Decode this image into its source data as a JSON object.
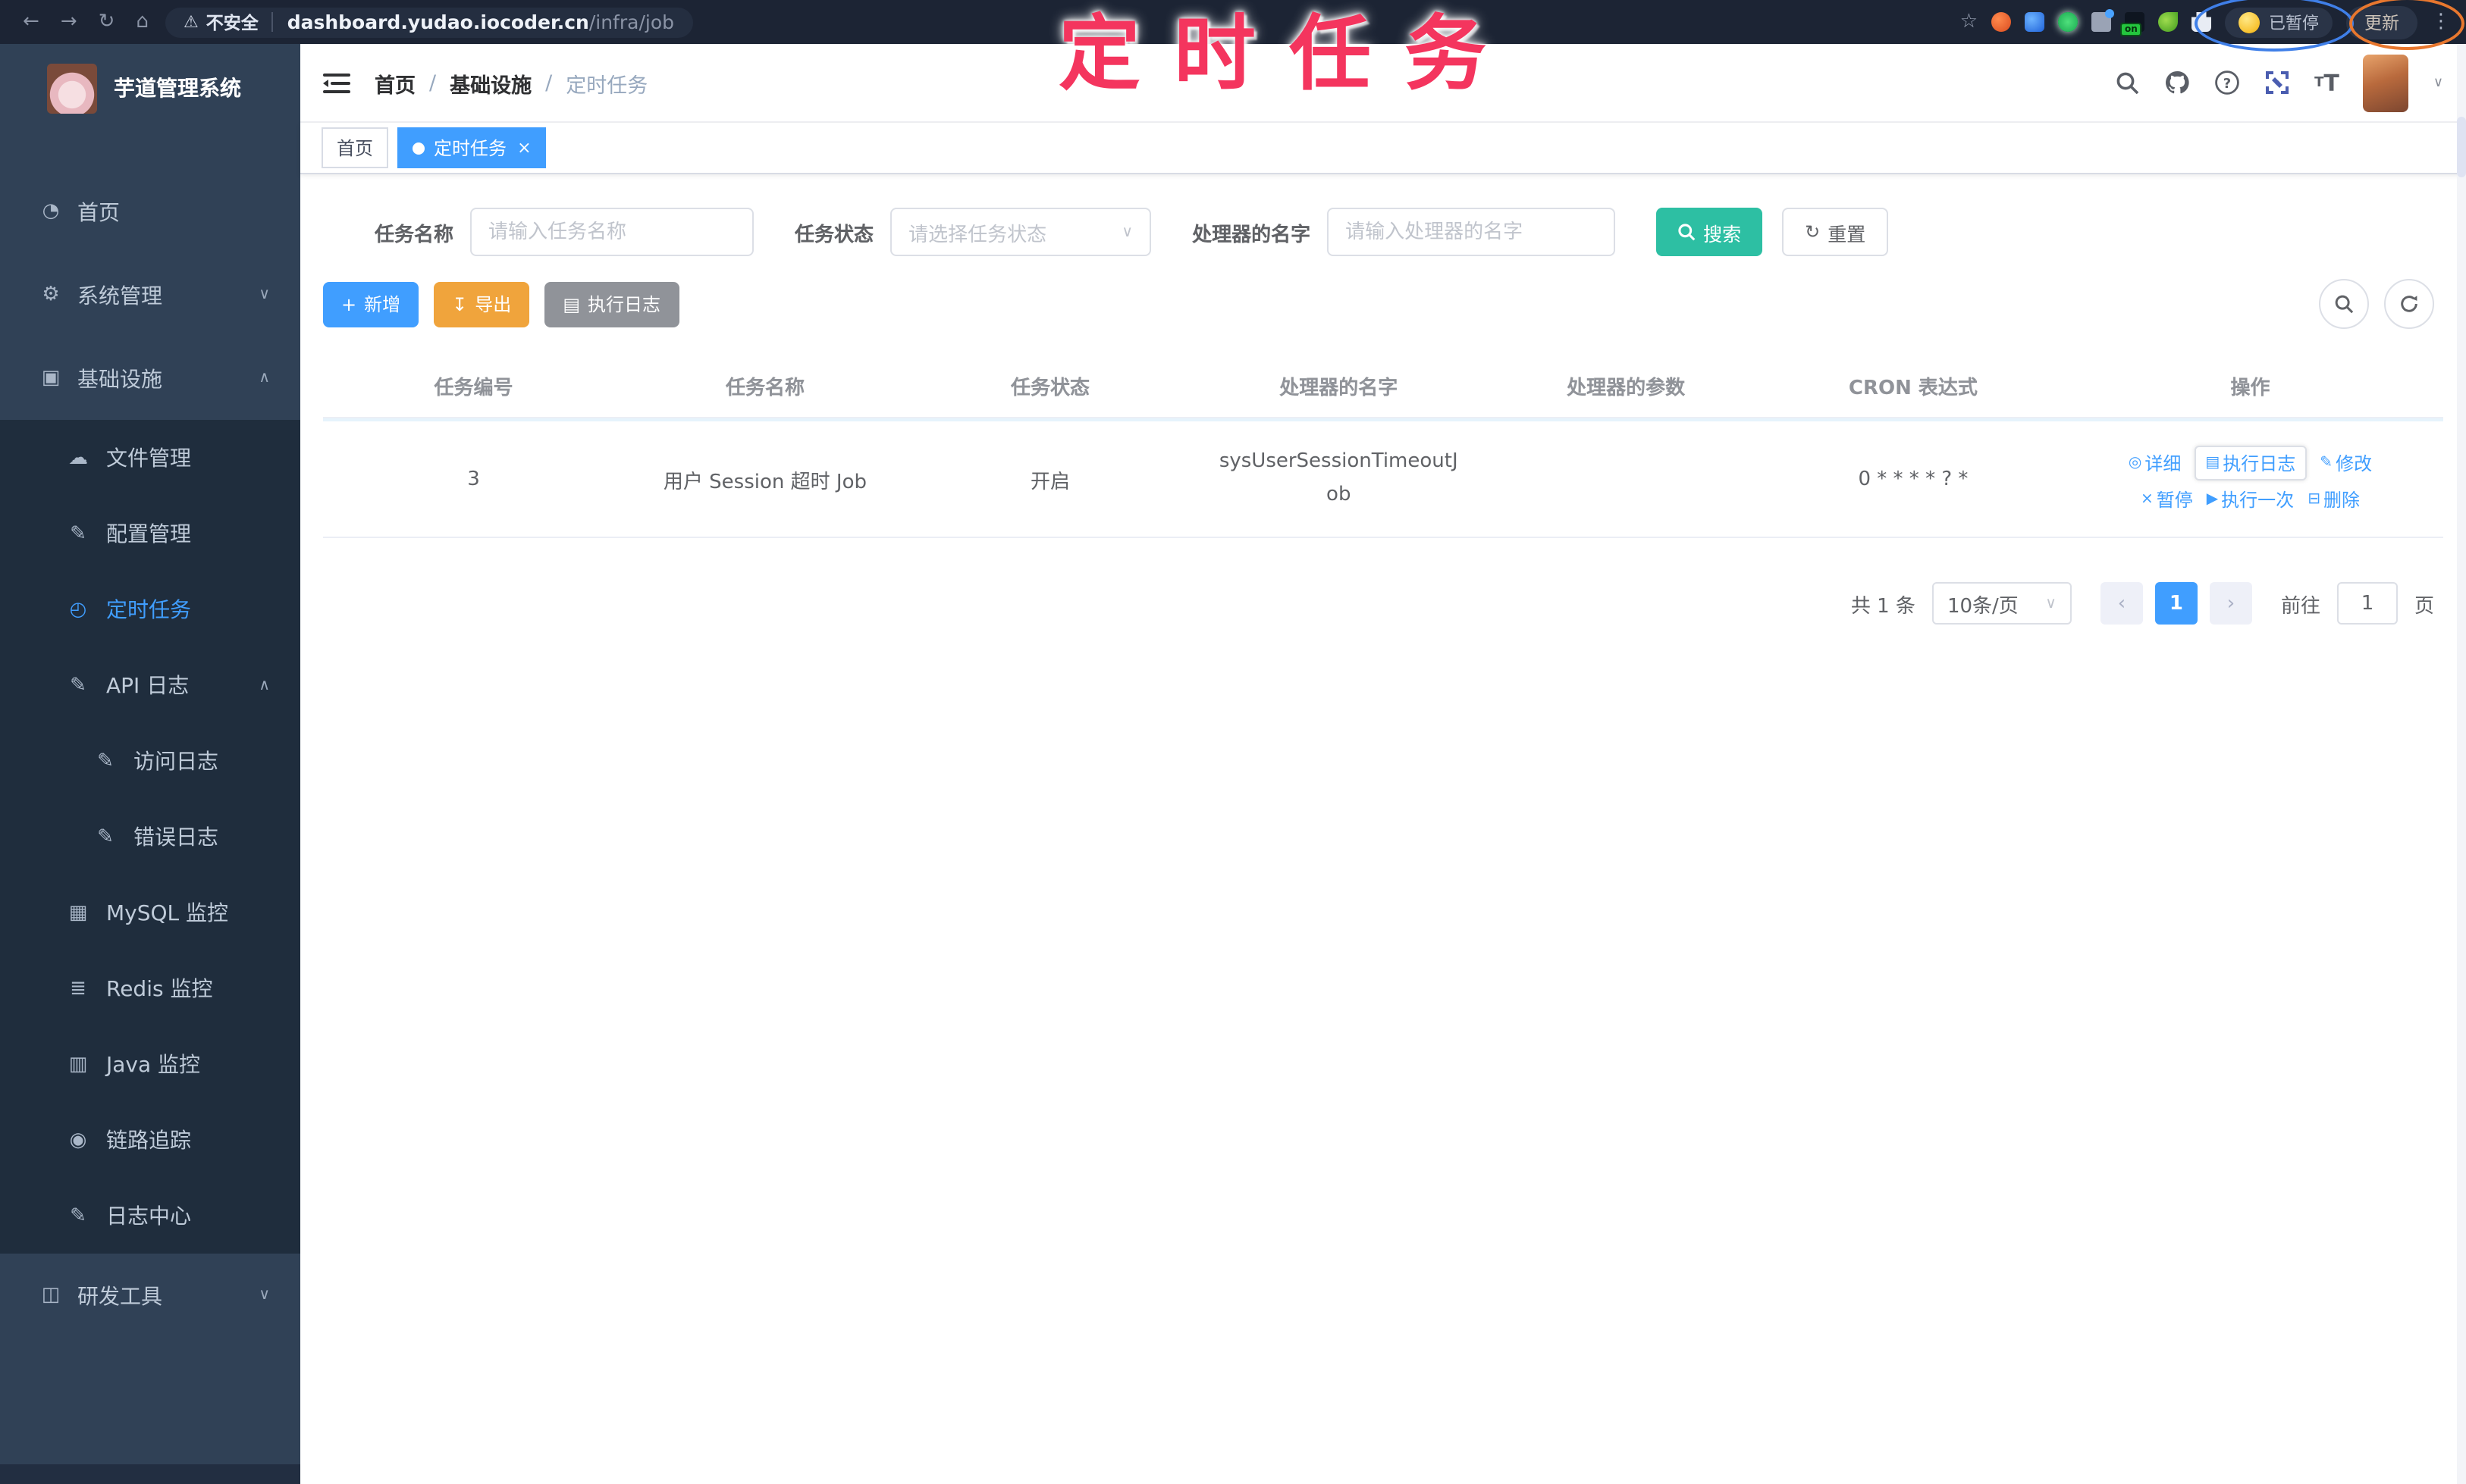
{
  "browser": {
    "security_label": "不安全",
    "url_host": "dashboard.yudao.iocoder.cn",
    "url_path": "/infra/job",
    "paused_label": "已暂停",
    "update_label": "更新",
    "ext_on_badge": "on"
  },
  "annotation": {
    "title": "定时任务"
  },
  "icons": {
    "back": "←",
    "forward": "→",
    "reload": "↻",
    "home_btn": "⌂",
    "warning": "⚠",
    "star": "☆",
    "dots": "⋮",
    "dashboard": "◔",
    "gear": "⚙",
    "infra": "▣",
    "cloud": "☁",
    "edit": "✎",
    "job": "◴",
    "image": "▦",
    "layers": "≣",
    "monitor": "▥",
    "eye": "◉",
    "briefcase": "◫",
    "chevron_down": "∨",
    "chevron_up": "∧",
    "plus": "+",
    "download": "↧",
    "loglist": "▤",
    "op_detail": "◎",
    "op_log": "▤",
    "op_edit": "✎",
    "op_pause": "×",
    "op_run": "▶",
    "op_delete": "⊟",
    "pager_prev": "‹",
    "pager_next": "›",
    "caret_select": "∨"
  },
  "sidebar": {
    "title": "芋道管理系统",
    "items": [
      {
        "label": "首页"
      },
      {
        "label": "系统管理"
      },
      {
        "label": "基础设施"
      },
      {
        "label": "文件管理"
      },
      {
        "label": "配置管理"
      },
      {
        "label": "定时任务"
      },
      {
        "label": "API 日志"
      },
      {
        "label": "访问日志"
      },
      {
        "label": "错误日志"
      },
      {
        "label": "MySQL 监控"
      },
      {
        "label": "Redis 监控"
      },
      {
        "label": "Java 监控"
      },
      {
        "label": "链路追踪"
      },
      {
        "label": "日志中心"
      },
      {
        "label": "研发工具"
      }
    ]
  },
  "navbar": {
    "breadcrumb": {
      "home": "首页",
      "section": "基础设施",
      "current": "定时任务",
      "separator": "/"
    }
  },
  "tabs": {
    "home": "首页",
    "current": "定时任务",
    "close": "×"
  },
  "filters": {
    "name_label": "任务名称",
    "name_placeholder": "请输入任务名称",
    "status_label": "任务状态",
    "status_placeholder": "请选择任务状态",
    "handler_label": "处理器的名字",
    "handler_placeholder": "请输入处理器的名字",
    "search_label": "搜索",
    "reset_label": "重置"
  },
  "toolbar": {
    "add_label": "新增",
    "export_label": "导出",
    "exec_log_label": "执行日志"
  },
  "table": {
    "columns": [
      "任务编号",
      "任务名称",
      "任务状态",
      "处理器的名字",
      "处理器的参数",
      "CRON 表达式",
      "操作"
    ],
    "row": {
      "id": "3",
      "name": "用户 Session 超时 Job",
      "status": "开启",
      "handler": "sysUserSessionTimeoutJob",
      "params": "",
      "cron": "0 * * * * ? *",
      "op_detail": "详细",
      "op_log": "执行日志",
      "op_edit": "修改",
      "op_pause": "暂停",
      "op_run": "执行一次",
      "op_delete": "删除"
    }
  },
  "pagination": {
    "total": "共 1 条",
    "page_size": "10条/页",
    "page": "1",
    "goto_label": "前往",
    "goto_value": "1",
    "page_suffix": "页"
  },
  "colors": {
    "accent": "#409EFF",
    "search_teal": "#2DBFA3",
    "export_orange": "#F0A43C",
    "info_gray": "#909399",
    "sidebar_bg": "#304156",
    "submenu_bg": "#1F2D3D",
    "annotation_pink": "#F4355E"
  }
}
